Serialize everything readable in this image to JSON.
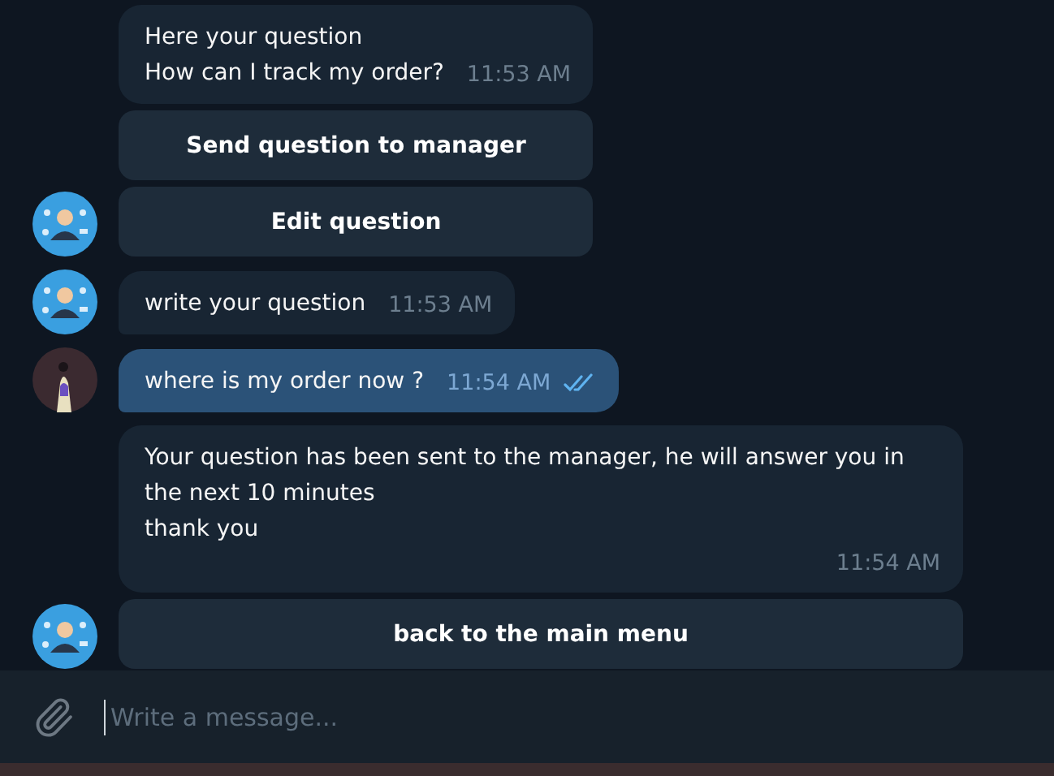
{
  "messages": [
    {
      "kind": "incoming",
      "avatar": {
        "kind": "bot"
      },
      "text": "Here your question\nHow can I track my order?",
      "time": "11:53 AM",
      "buttons": [
        "Send question to manager",
        "Edit question"
      ]
    },
    {
      "kind": "incoming",
      "avatar": {
        "kind": "bot"
      },
      "text": "write your question",
      "time": "11:53 AM"
    },
    {
      "kind": "outgoing",
      "avatar": {
        "kind": "user"
      },
      "text": "where is my order now ?",
      "time": "11:54 AM",
      "read": true
    },
    {
      "kind": "incoming",
      "avatar": {
        "kind": "bot"
      },
      "text": "Your question has been sent to the manager, he will answer you in the next 10 minutes\nthank you",
      "time": "11:54 AM",
      "buttons": [
        "back to the main menu"
      ]
    }
  ],
  "composer": {
    "placeholder": "Write a message..."
  }
}
